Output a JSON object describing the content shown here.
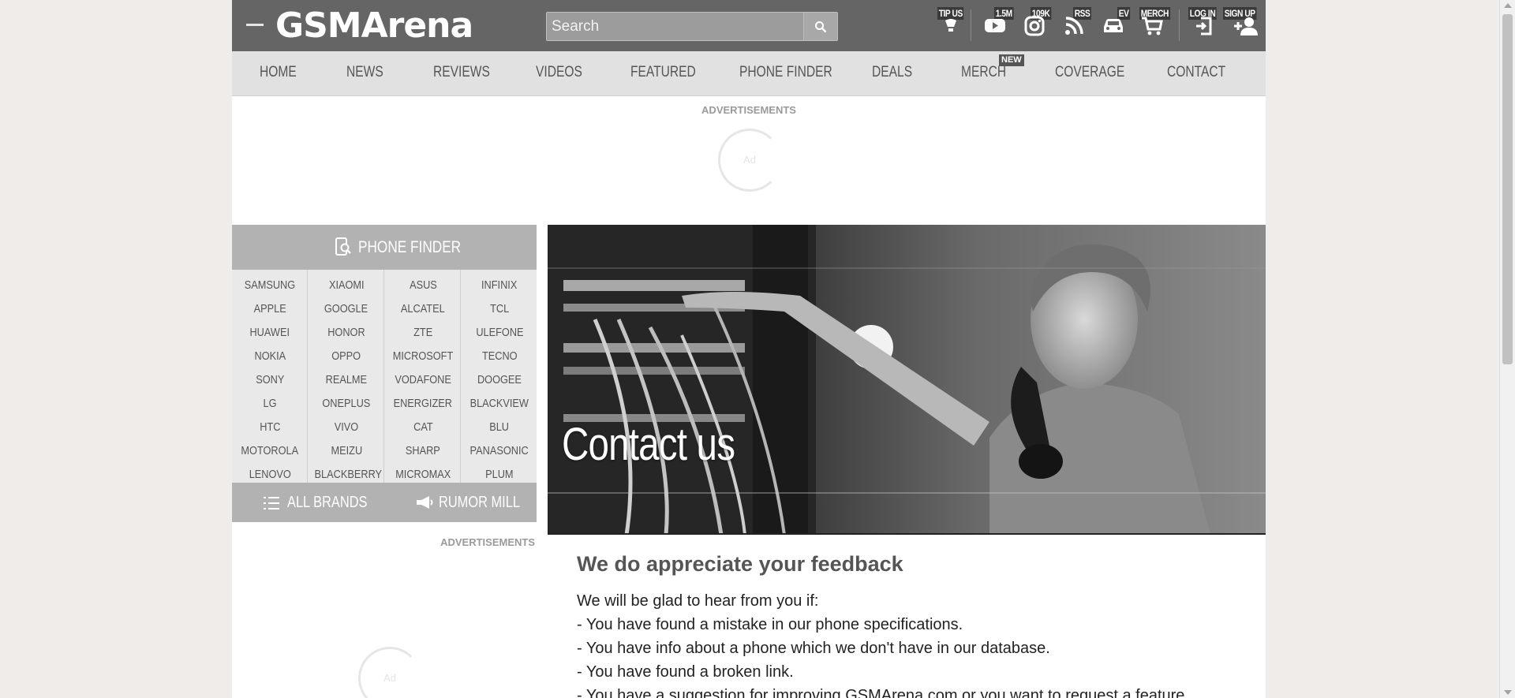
{
  "header": {
    "logo": "GSMArena",
    "search_placeholder": "Search",
    "icons": [
      {
        "label": "TIP US",
        "icon": "lightbulb-icon"
      },
      {
        "label": "1.5M",
        "icon": "youtube-icon"
      },
      {
        "label": "109K",
        "icon": "instagram-icon"
      },
      {
        "label": "RSS",
        "icon": "rss-icon"
      },
      {
        "label": "EV",
        "icon": "car-icon"
      },
      {
        "label": "MERCH",
        "icon": "cart-icon"
      },
      {
        "label": "LOG IN",
        "icon": "login-icon"
      },
      {
        "label": "SIGN UP",
        "icon": "add-user-icon"
      }
    ]
  },
  "nav": {
    "items": [
      "HOME",
      "NEWS",
      "REVIEWS",
      "VIDEOS",
      "FEATURED",
      "PHONE FINDER",
      "DEALS",
      "MERCH",
      "COVERAGE",
      "CONTACT"
    ],
    "new_badge": "NEW"
  },
  "ads": {
    "label": "ADVERTISEMENTS",
    "placeholder": "Ad"
  },
  "sidebar": {
    "phone_finder_title": "PHONE FINDER",
    "brands": [
      [
        "SAMSUNG",
        "APPLE",
        "HUAWEI",
        "NOKIA",
        "SONY",
        "LG",
        "HTC",
        "MOTOROLA",
        "LENOVO"
      ],
      [
        "XIAOMI",
        "GOOGLE",
        "HONOR",
        "OPPO",
        "REALME",
        "ONEPLUS",
        "VIVO",
        "MEIZU",
        "BLACKBERRY"
      ],
      [
        "ASUS",
        "ALCATEL",
        "ZTE",
        "MICROSOFT",
        "VODAFONE",
        "ENERGIZER",
        "CAT",
        "SHARP",
        "MICROMAX"
      ],
      [
        "INFINIX",
        "TCL",
        "ULEFONE",
        "TECNO",
        "DOOGEE",
        "BLACKVIEW",
        "BLU",
        "PANASONIC",
        "PLUM"
      ]
    ],
    "all_brands": "ALL BRANDS",
    "rumor_mill": "RUMOR MILL"
  },
  "hero": {
    "title": "Contact us"
  },
  "content": {
    "heading": "We do appreciate your feedback",
    "lines": [
      "We will be glad to hear from you if:",
      "- You have found a mistake in our phone specifications.",
      "- You have info about a phone which we don't have in our database.",
      "- You have found a broken link.",
      "- You have a suggestion for improving GSMArena.com or you want to request a feature."
    ]
  }
}
